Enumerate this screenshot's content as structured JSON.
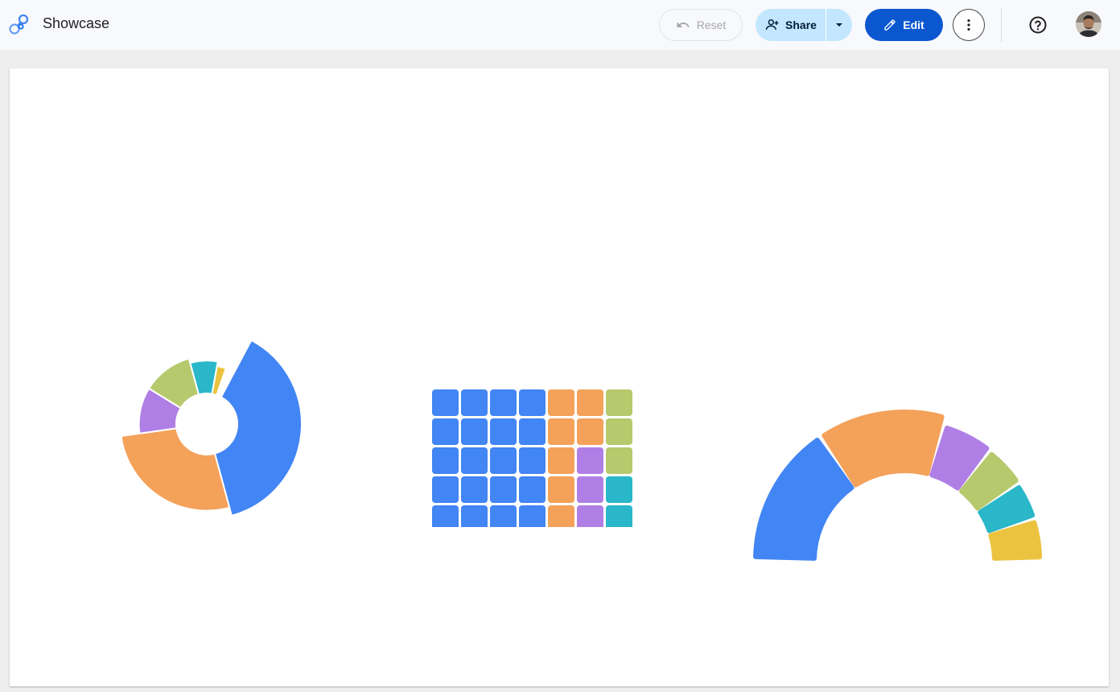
{
  "app": {
    "title": "Showcase"
  },
  "toolbar": {
    "reset_label": "Reset",
    "share_label": "Share",
    "edit_label": "Edit"
  },
  "icons": {
    "logo": "looker-studio-logo",
    "reset": "undo-icon",
    "share": "person-add-icon",
    "share_menu": "caret-down-icon",
    "edit": "pencil-icon",
    "more": "more-vert-icon",
    "help": "help-circle-icon",
    "avatar": "user-avatar"
  },
  "colors": {
    "blue": "#4285f4",
    "orange": "#f4a15a",
    "purple": "#b07fe6",
    "green": "#b6c96d",
    "teal": "#2ab7c9",
    "yellow": "#ebc33f",
    "pink": "#e774b8"
  },
  "chart_data": [
    {
      "type": "pie",
      "variant": "rose-donut",
      "slices": [
        {
          "color": "#4285f4",
          "share": 0.38,
          "radius": 1.0
        },
        {
          "color": "#f4a15a",
          "share": 0.27,
          "radius": 0.87
        },
        {
          "color": "#b07fe6",
          "share": 0.11,
          "radius": 0.58
        },
        {
          "color": "#b6c96d",
          "share": 0.12,
          "radius": 0.58
        },
        {
          "color": "#2ab7c9",
          "share": 0.07,
          "radius": 0.51
        },
        {
          "color": "#ebc33f",
          "share": 0.025,
          "radius": 0.44
        },
        {
          "color": "#ebc33f",
          "share": 0.005,
          "radius": 0.4
        }
      ]
    },
    {
      "type": "heatmap",
      "variant": "waffle",
      "rows": 7,
      "cols": 7,
      "cells": [
        [
          "#4285f4",
          "#4285f4",
          "#4285f4",
          "#4285f4",
          "#f4a15a",
          "#f4a15a",
          "#b6c96d"
        ],
        [
          "#4285f4",
          "#4285f4",
          "#4285f4",
          "#4285f4",
          "#f4a15a",
          "#f4a15a",
          "#b6c96d"
        ],
        [
          "#4285f4",
          "#4285f4",
          "#4285f4",
          "#4285f4",
          "#f4a15a",
          "#b07fe6",
          "#b6c96d"
        ],
        [
          "#4285f4",
          "#4285f4",
          "#4285f4",
          "#4285f4",
          "#f4a15a",
          "#b07fe6",
          "#2ab7c9"
        ],
        [
          "#4285f4",
          "#4285f4",
          "#4285f4",
          "#4285f4",
          "#f4a15a",
          "#b07fe6",
          "#2ab7c9"
        ],
        [
          "#4285f4",
          "#4285f4",
          "#4285f4",
          "#4285f4",
          "#f4a15a",
          "#b07fe6",
          "#ebc33f"
        ],
        [
          "#4285f4",
          "#4285f4",
          "#4285f4",
          "#f4a15a",
          "#f4a15a",
          "#b6c96d",
          "#e774b8"
        ]
      ]
    },
    {
      "type": "pie",
      "variant": "half-donut",
      "slices": [
        {
          "color": "#4285f4",
          "share": 0.31,
          "radius": 1.0
        },
        {
          "color": "#f4a15a",
          "share": 0.28,
          "radius": 1.0
        },
        {
          "color": "#b07fe6",
          "share": 0.12,
          "radius": 0.84
        },
        {
          "color": "#b6c96d",
          "share": 0.1,
          "radius": 0.81
        },
        {
          "color": "#2ab7c9",
          "share": 0.09,
          "radius": 0.78
        },
        {
          "color": "#ebc33f",
          "share": 0.1,
          "radius": 0.77
        }
      ]
    }
  ]
}
